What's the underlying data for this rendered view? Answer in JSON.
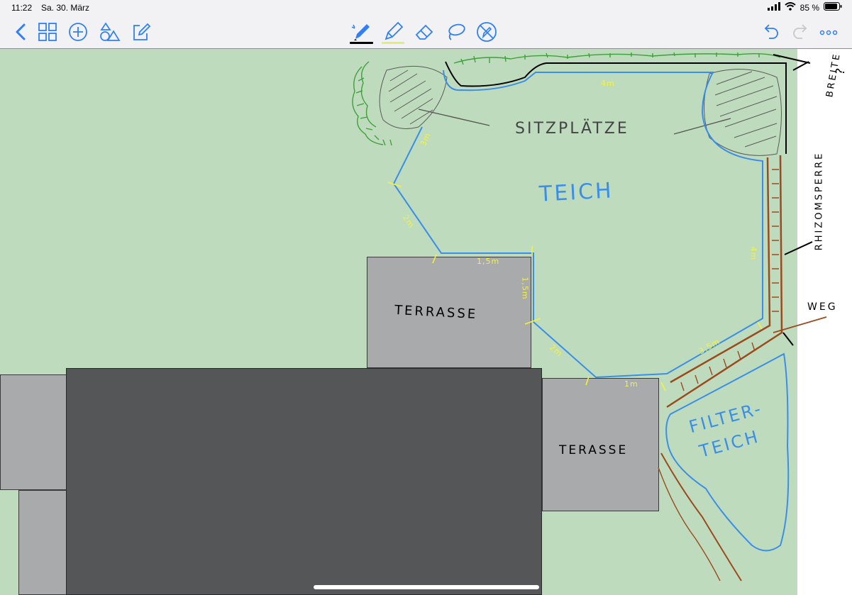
{
  "status_bar": {
    "time": "11:22",
    "date": "Sa. 30. März",
    "battery": "85 %"
  },
  "toolbar": {
    "icons": [
      "back-icon",
      "grid-icon",
      "add-icon",
      "shapes-icon",
      "compose-icon",
      "pen-icon",
      "highlighter-icon",
      "eraser-icon",
      "lasso-icon",
      "no-scroll-icon",
      "undo-icon",
      "redo-icon",
      "more-icon"
    ],
    "pen_color": "#000000",
    "highlighter_color": "#e0ee7a",
    "accent": "#2f7ff7"
  },
  "drawing": {
    "labels": {
      "sitzplaetze": "SITZPLÄTZE",
      "teich": "TEICH",
      "terrasse_1": "TERRASSE",
      "terrasse_2": "TERASSE",
      "filterteich_1": "FILTER-",
      "filterteich_2": "TEICH",
      "rhizomsperre": "RHIZOMSPERRE",
      "breite": "BREITE",
      "breite_q": "?",
      "weg": "WEG"
    },
    "measurements": [
      "4m",
      "3m",
      "2m",
      "1,5m",
      "1,5m",
      "2m",
      "1m",
      "4m",
      "3,5m"
    ],
    "colors": {
      "lawn": "#bedcbd",
      "house": "#555658",
      "terrace": "#a9aaac",
      "pond_outline": "#3b8ee8",
      "measure": "#f6f23a",
      "path": "#9b4a1e",
      "plants": "#3fa03a"
    }
  }
}
